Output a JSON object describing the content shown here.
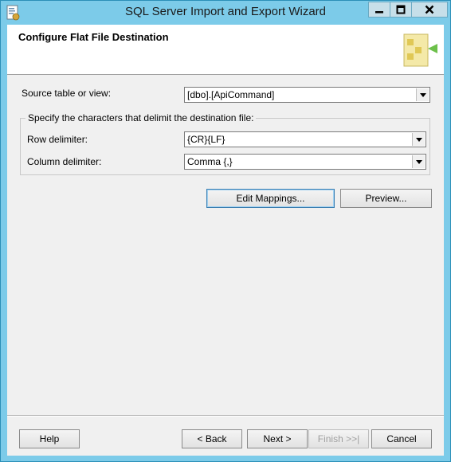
{
  "window": {
    "title": "SQL Server Import and Export Wizard"
  },
  "header": {
    "title": "Configure Flat File Destination"
  },
  "source": {
    "label": "Source table or view:",
    "value": "[dbo].[ApiCommand]"
  },
  "delimiters": {
    "group_label": "Specify the characters that delimit the destination file:",
    "row_label": "Row delimiter:",
    "row_value": "{CR}{LF}",
    "column_label": "Column delimiter:",
    "column_value": "Comma {,}"
  },
  "actions": {
    "edit_mappings": "Edit Mappings...",
    "preview": "Preview..."
  },
  "footer": {
    "help": "Help",
    "back": "< Back",
    "next": "Next >",
    "finish": "Finish >>|",
    "cancel": "Cancel"
  },
  "icons": {
    "app": "wizard-app-icon",
    "header": "flat-file-icon",
    "minimize": "minimize-icon",
    "maximize": "maximize-icon",
    "close": "close-icon",
    "dropdown": "chevron-down-icon"
  },
  "colors": {
    "frame": "#7ccbe9",
    "client": "#f0f0f0",
    "header_bg": "#ffffff",
    "accent": "#3c7fb1"
  }
}
